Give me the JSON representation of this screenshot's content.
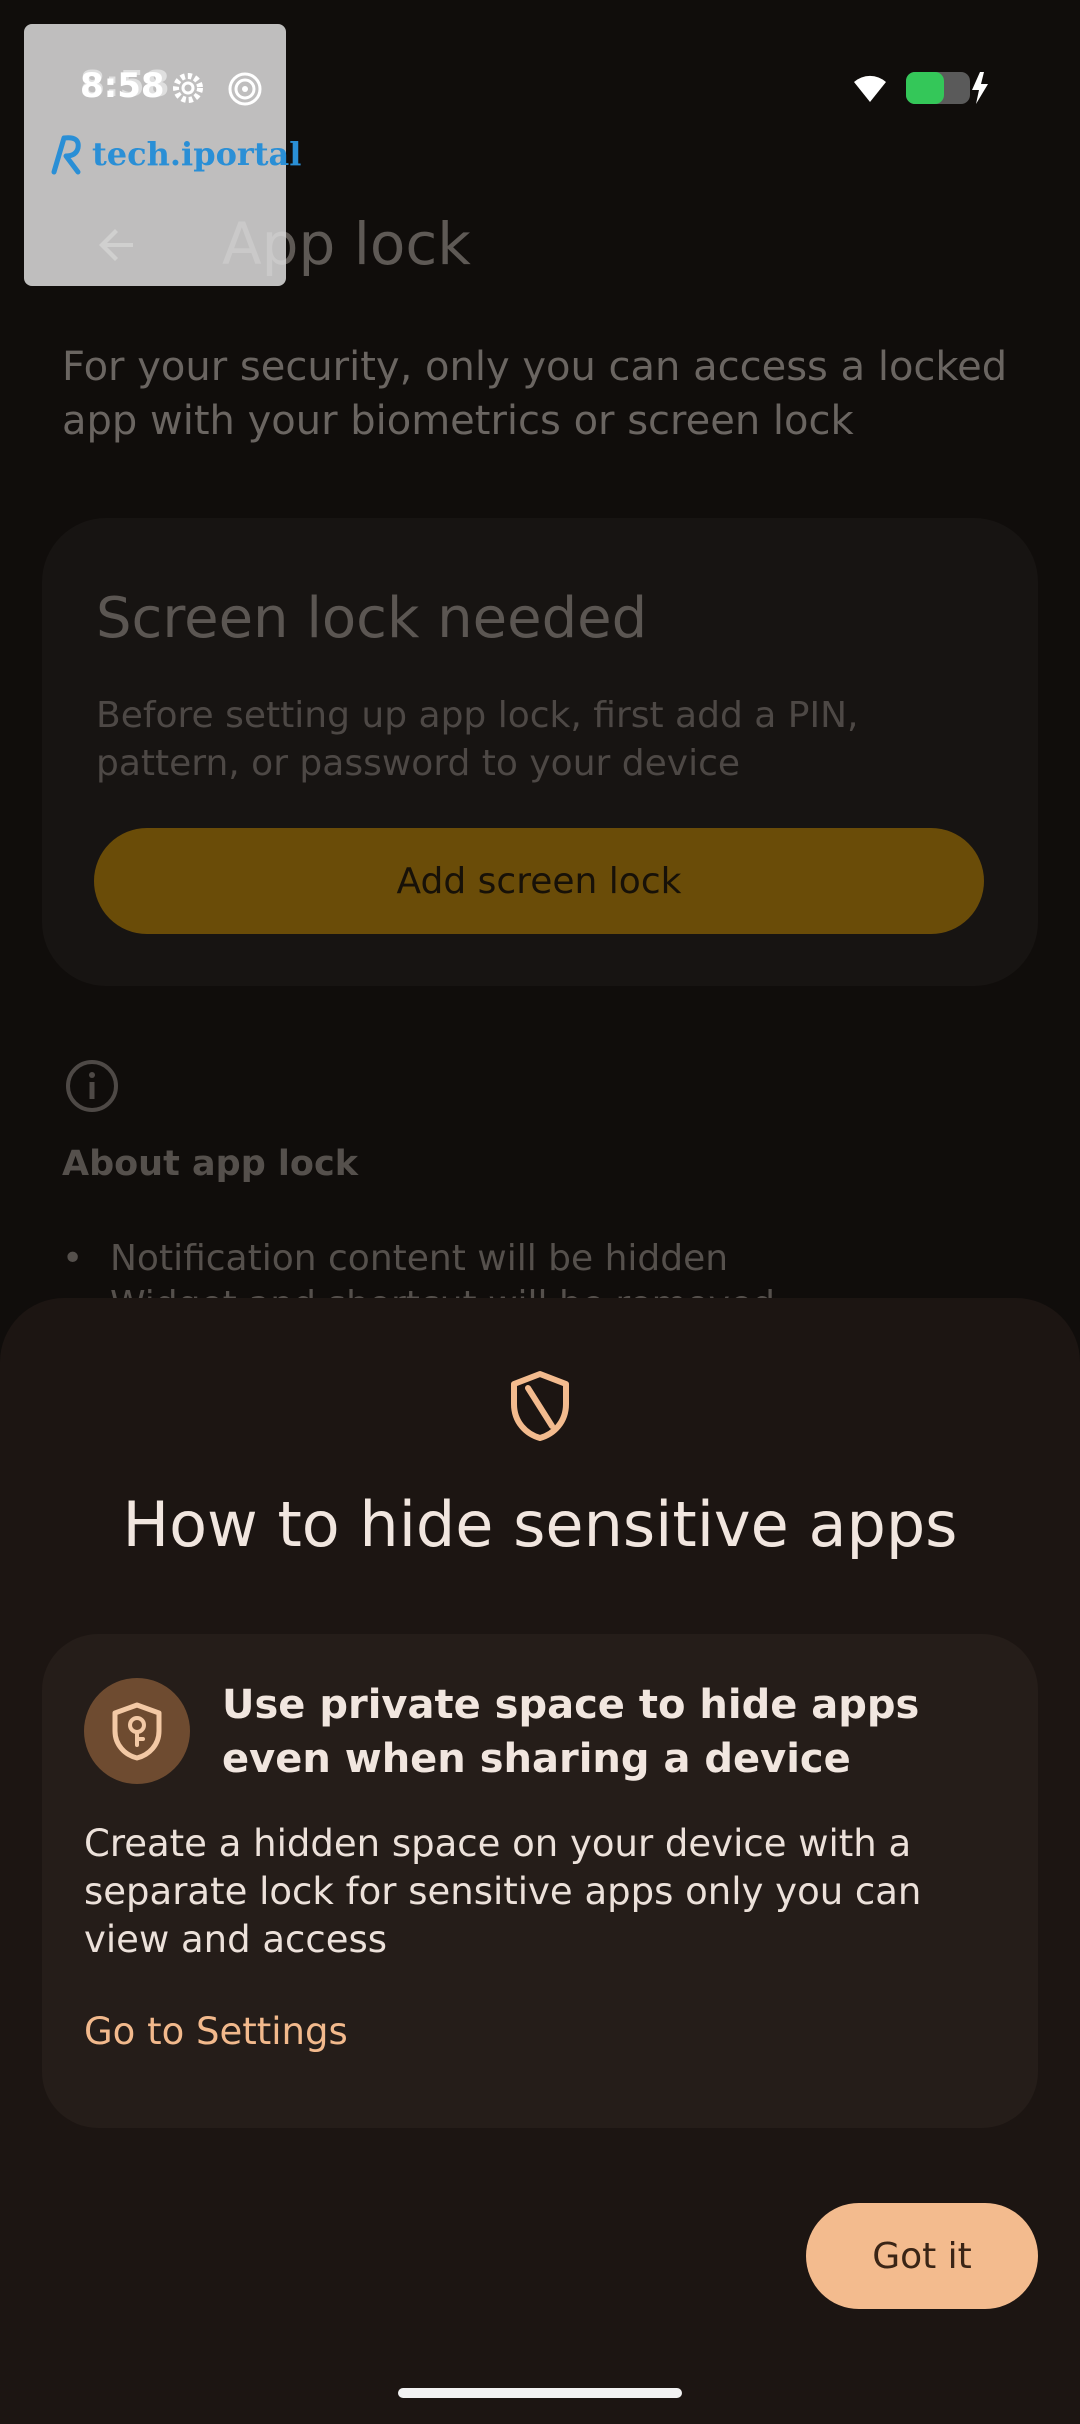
{
  "status_bar": {
    "time": "8:58",
    "icons": [
      "gear-icon",
      "spiral-icon",
      "wifi-icon",
      "battery-charging-icon"
    ],
    "battery_color": "#34c759"
  },
  "watermark": {
    "logo_text": "tech.iportal"
  },
  "appbar": {
    "title": "App lock",
    "back_icon": "arrow-back-icon"
  },
  "background_page": {
    "description": "For your security, only you can access a locked app with your biometrics or screen lock",
    "screen_lock_card": {
      "title": "Screen lock needed",
      "text": "Before setting up app lock, first add a PIN, pattern, or password to your device",
      "button_label": "Add screen lock"
    },
    "about": {
      "title": "About app lock",
      "bullets": [
        "Notification content will be hidden",
        "Widget and shortcut will be removed"
      ]
    }
  },
  "sheet": {
    "icon": "shield-icon",
    "title": "How to hide sensitive apps",
    "feature_card": {
      "icon": "key-shield-icon",
      "title": "Use private space to hide apps even when sharing a device",
      "text": "Create a hidden space on your device with a separate lock for sensitive apps only you can view and access",
      "link_label": "Go to Settings"
    },
    "primary_button": "Got it"
  },
  "colors": {
    "accent": "#f3bb8e",
    "sheet_bg": "#1c1512",
    "card_bg": "#251d19",
    "dimmed_button": "#6a4c08"
  }
}
